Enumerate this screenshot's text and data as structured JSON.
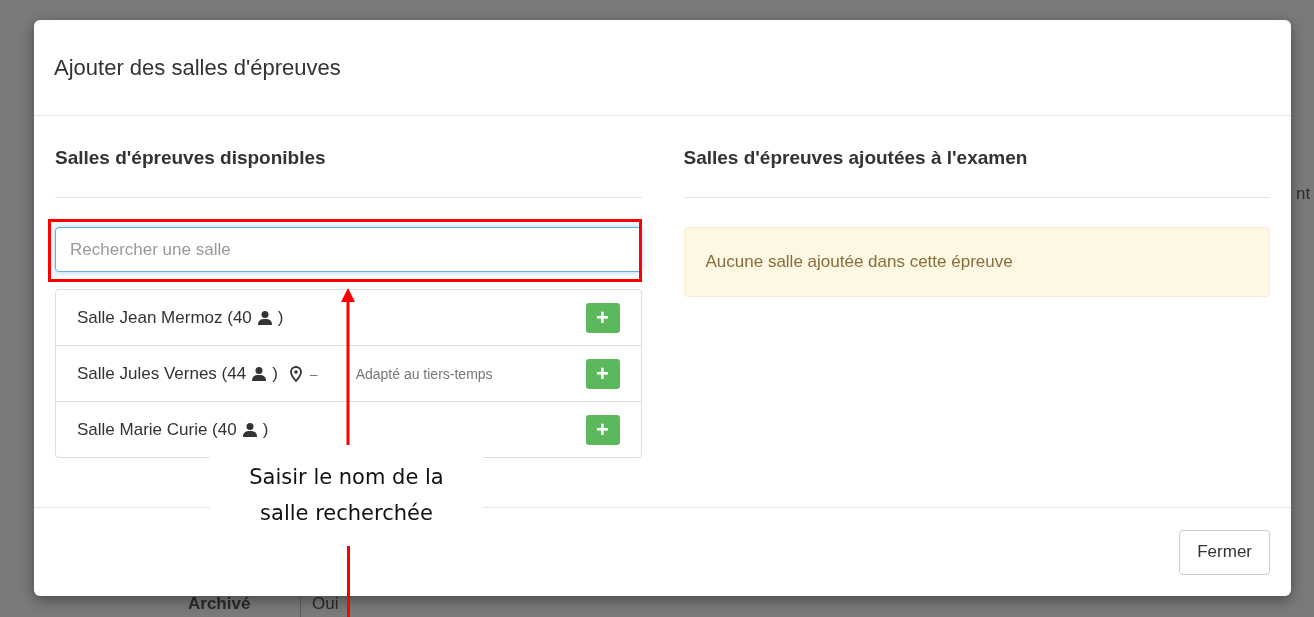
{
  "background": {
    "texts": [
      {
        "kind": "label",
        "text": "Archivé"
      },
      {
        "kind": "value",
        "text": "Oui"
      },
      {
        "kind": "edge",
        "text": "nt"
      }
    ]
  },
  "dialog": {
    "title": "Ajouter des salles d'épreuves",
    "available": {
      "heading": "Salles d'épreuves disponibles",
      "search": {
        "placeholder": "Rechercher une salle"
      },
      "rooms": [
        {
          "name": "Salle Jean Mermoz (40",
          "close": ")",
          "add": "+"
        },
        {
          "name": "Salle Jules Vernes (44",
          "close": ")",
          "dash": "–",
          "note": "Adapté au tiers-temps",
          "add": "+"
        },
        {
          "name": "Salle Marie Curie (40",
          "close": ")",
          "add": "+"
        }
      ]
    },
    "added": {
      "heading": "Salles d'épreuves ajoutées à l'examen",
      "empty_message": "Aucune salle ajoutée dans cette épreuve"
    },
    "buttons": [
      "Fermer"
    ]
  },
  "annotation": {
    "callout": "Saisir le nom de la salle recherchée"
  }
}
